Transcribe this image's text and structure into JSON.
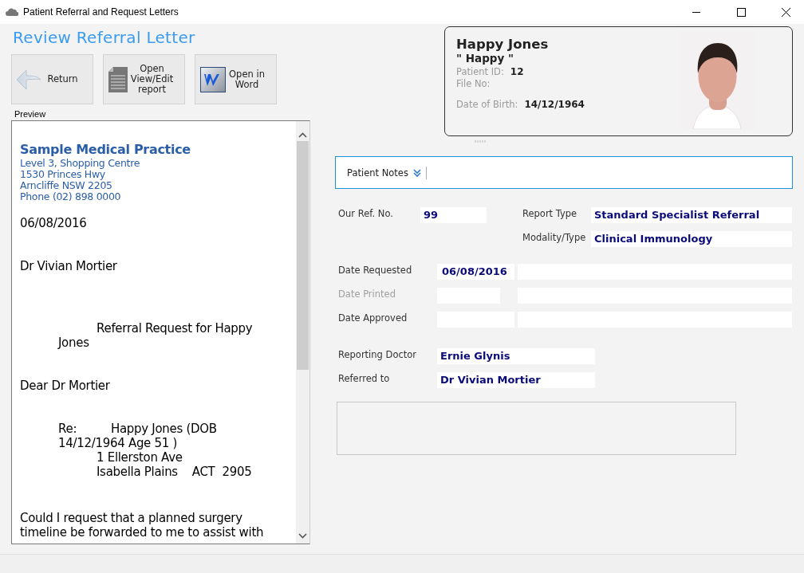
{
  "window": {
    "title": "Patient Referral and Request Letters"
  },
  "heading": "Review Referral Letter",
  "toolbar": [
    {
      "kind": "return",
      "label": "Return"
    },
    {
      "kind": "report",
      "label": "Open View/Edit report"
    },
    {
      "kind": "word",
      "label": "Open in Word"
    }
  ],
  "preview": {
    "label": "Preview",
    "lines": [
      {
        "kind": "practice-name",
        "text": "Sample Medical Practice"
      },
      {
        "kind": "practice-line",
        "text": "Level 3, Shopping Centre"
      },
      {
        "kind": "practice-line",
        "text": "1530 Princes Hwy"
      },
      {
        "kind": "practice-line",
        "text": "Arncliffe NSW 2205"
      },
      {
        "kind": "practice-line",
        "text": "Phone (02) 898 0000"
      },
      {
        "kind": "date",
        "text": "06/08/2016"
      },
      {
        "kind": "recipient",
        "text": "Dr Vivian Mortier"
      },
      {
        "kind": "subject",
        "text": "Referral Request for Happy"
      },
      {
        "kind": "indent1",
        "text": "Jones"
      },
      {
        "kind": "salutation",
        "text": "Dear Dr Mortier"
      },
      {
        "kind": "re",
        "label": "Re:",
        "text": "Happy Jones (DOB"
      },
      {
        "kind": "indent1",
        "text": "14/12/1964 Age 51 )"
      },
      {
        "kind": "indent2",
        "text": "1 Ellerston Ave"
      },
      {
        "kind": "indent2",
        "text": "Isabella Plains    ACT  2905"
      },
      {
        "kind": "body",
        "text": "Could I request that a planned surgery"
      },
      {
        "kind": "line",
        "text": "timeline be forwarded to me to assist with"
      }
    ]
  },
  "patient": {
    "name": "Happy Jones",
    "nickname": "\" Happy \"",
    "fields": [
      {
        "label": "Patient ID:",
        "value": "12"
      },
      {
        "label": "File No:"
      },
      {
        "label": "Date of Birth:",
        "value": "14/12/1964"
      }
    ]
  },
  "notes": {
    "label": "Patient Notes",
    "expanded": false
  },
  "form": {
    "ref": {
      "label": "Our Ref. No.",
      "value": "99"
    },
    "report_type": {
      "label": "Report Type",
      "value": "Standard Specialist Referral"
    },
    "modality": {
      "label": "Modality/Type",
      "value": "Clinical Immunology"
    },
    "dates": [
      {
        "label": "Date Requested",
        "value": "06/08/2016",
        "disabled": false
      },
      {
        "label": "Date Printed",
        "disabled": true
      },
      {
        "label": "Date Approved",
        "disabled": false
      }
    ],
    "reporting_doctor": {
      "label": "Reporting Doctor",
      "value": "Ernie Glynis"
    },
    "referred_to": {
      "label": "Referred to",
      "value": "Dr Vivian Mortier"
    }
  }
}
